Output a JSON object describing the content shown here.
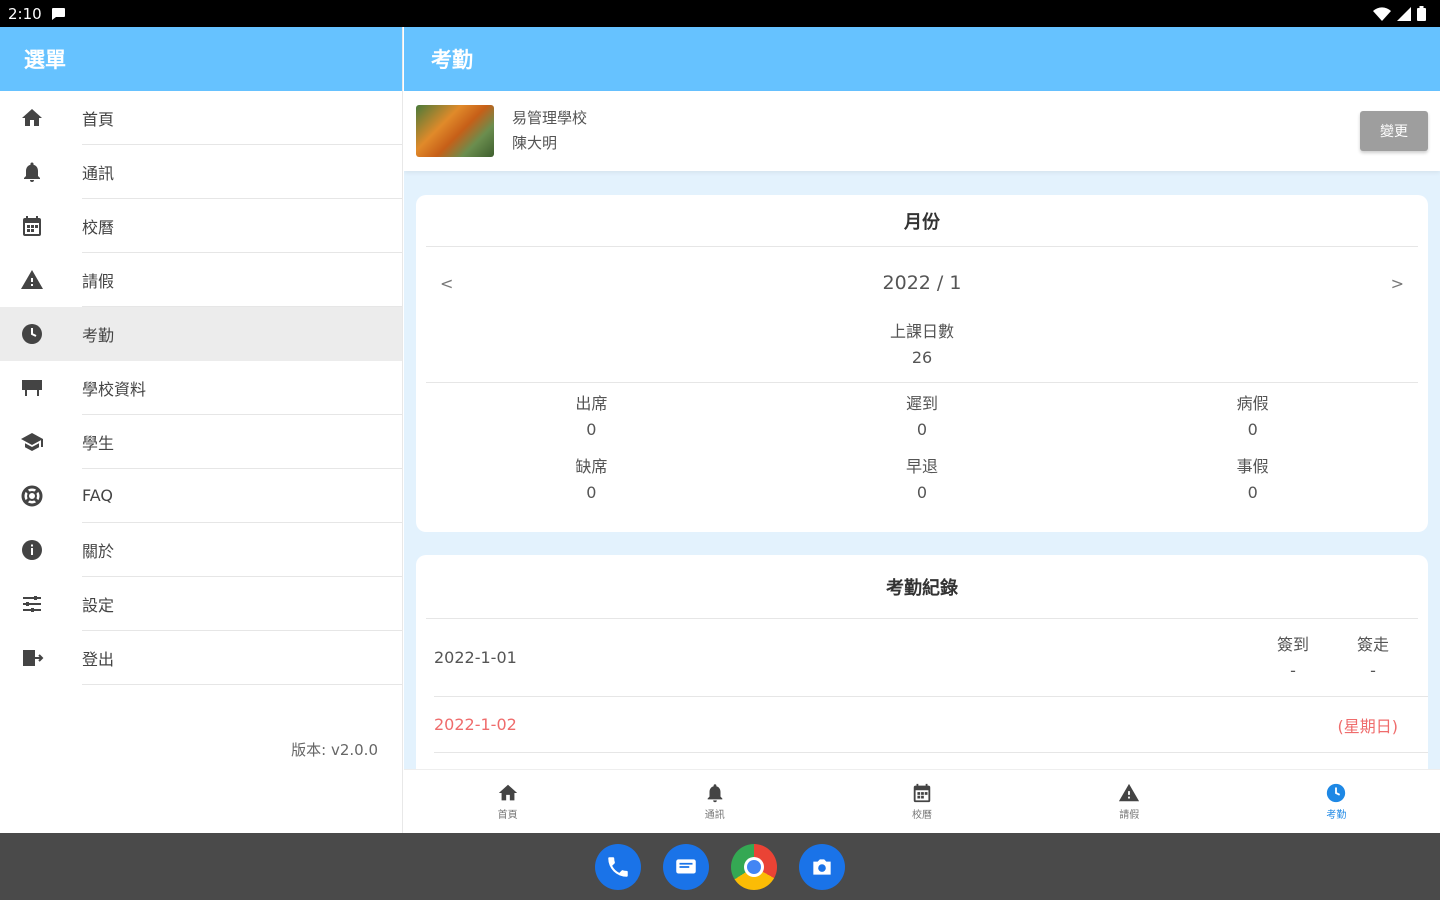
{
  "status": {
    "time": "2:10"
  },
  "sidebar": {
    "title": "選單",
    "items": [
      {
        "label": "首頁",
        "icon": "home-icon"
      },
      {
        "label": "通訊",
        "icon": "bell-icon"
      },
      {
        "label": "校曆",
        "icon": "calendar-icon"
      },
      {
        "label": "請假",
        "icon": "warning-icon"
      },
      {
        "label": "考勤",
        "icon": "clock-icon",
        "active": true
      },
      {
        "label": "學校資料",
        "icon": "school-icon"
      },
      {
        "label": "學生",
        "icon": "graduation-cap-icon"
      },
      {
        "label": "FAQ",
        "icon": "lifebuoy-icon"
      },
      {
        "label": "關於",
        "icon": "info-icon"
      },
      {
        "label": "設定",
        "icon": "sliders-icon"
      },
      {
        "label": "登出",
        "icon": "logout-icon"
      }
    ],
    "version": "版本: v2.0.0"
  },
  "main": {
    "title": "考勤",
    "profile": {
      "school": "易管理學校",
      "name": "陳大明",
      "change_label": "變更"
    },
    "month_card": {
      "title": "月份",
      "prev": "<",
      "month": "2022 / 1",
      "next": ">",
      "school_days_label": "上課日數",
      "school_days_value": "26",
      "stats": [
        {
          "label": "出席",
          "value": "0"
        },
        {
          "label": "遲到",
          "value": "0"
        },
        {
          "label": "病假",
          "value": "0"
        },
        {
          "label": "缺席",
          "value": "0"
        },
        {
          "label": "早退",
          "value": "0"
        },
        {
          "label": "事假",
          "value": "0"
        }
      ]
    },
    "records_card": {
      "title": "考勤紀錄",
      "col_in": "簽到",
      "col_out": "簽走",
      "rows": [
        {
          "date": "2022-1-01",
          "in": "-",
          "out": "-"
        },
        {
          "date": "2022-1-02",
          "note": "(星期日)"
        }
      ]
    }
  },
  "bottom_nav": [
    {
      "label": "首頁",
      "icon": "home-icon"
    },
    {
      "label": "通訊",
      "icon": "bell-icon"
    },
    {
      "label": "校曆",
      "icon": "calendar-icon"
    },
    {
      "label": "請假",
      "icon": "warning-icon"
    },
    {
      "label": "考勤",
      "icon": "clock-icon",
      "active": true
    }
  ],
  "colors": {
    "header": "#66c2ff",
    "active_nav": "#1e88e5",
    "holiday": "#ef6c6c",
    "background": "#e3f2fd"
  }
}
